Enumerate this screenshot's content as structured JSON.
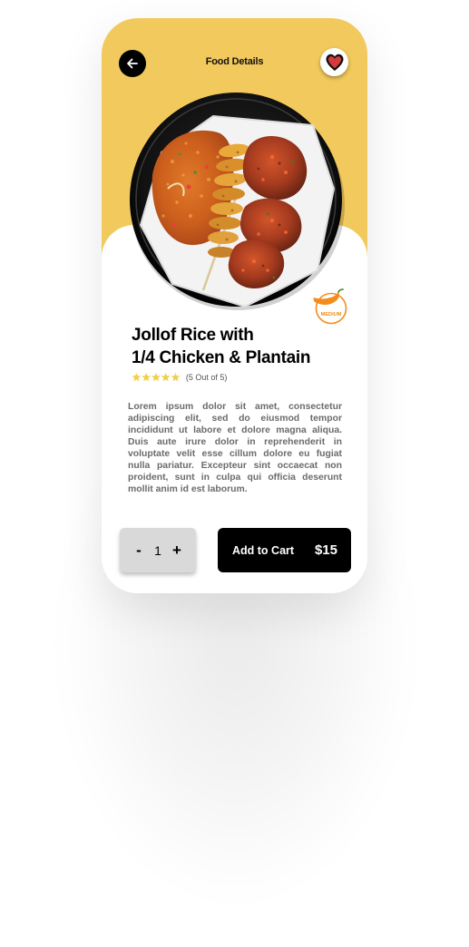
{
  "header": {
    "title": "Food Details"
  },
  "dish": {
    "name_line1": "Jollof Rice with",
    "name_line2": "1/4 Chicken & Plantain",
    "rating_value": 5,
    "rating_text": "(5 Out of 5)",
    "spice_level": "MEDIUM",
    "description": "Lorem ipsum dolor sit amet, consectetur adipiscing elit, sed do eiusmod tempor incididunt ut labore et dolore magna aliqua. Duis aute irure dolor in reprehenderit in voluptate velit esse cillum dolore eu fugiat nulla pariatur. Excepteur sint occaecat non proident, sunt in culpa qui officia deserunt mollit anim id est laborum."
  },
  "cart": {
    "decrement_label": "-",
    "quantity": "1",
    "increment_label": "+",
    "add_label": "Add to Cart",
    "price": "$15"
  },
  "icons": {
    "back": "arrow-left-icon",
    "favorite": "heart-icon",
    "spice": "chili-pepper-icon",
    "star": "star-icon"
  },
  "colors": {
    "accent_yellow": "#f2c95c",
    "button_black": "#000000",
    "stepper_gray": "#d9d9d9",
    "heart_red": "#d63a3a",
    "spice_orange": "#f28c1c",
    "star_yellow": "#f6cf3c"
  }
}
